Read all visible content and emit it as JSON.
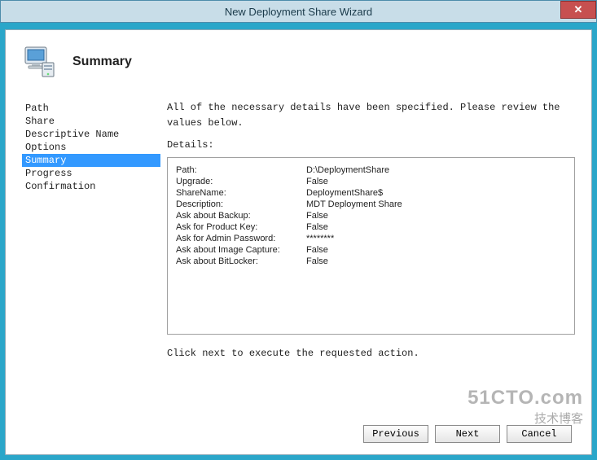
{
  "window": {
    "title": "New Deployment Share Wizard",
    "close": "✕"
  },
  "header": {
    "title": "Summary"
  },
  "nav": {
    "items": [
      {
        "label": "Path",
        "selected": false
      },
      {
        "label": "Share",
        "selected": false
      },
      {
        "label": "Descriptive Name",
        "selected": false
      },
      {
        "label": "Options",
        "selected": false
      },
      {
        "label": "Summary",
        "selected": true
      },
      {
        "label": "Progress",
        "selected": false
      },
      {
        "label": "Confirmation",
        "selected": false
      }
    ]
  },
  "main": {
    "intro": "All of the necessary details have been specified.  Please review the values below.",
    "details_label": "Details:",
    "details": [
      {
        "key": "Path:",
        "value": "D:\\DeploymentShare"
      },
      {
        "key": "Upgrade:",
        "value": "False"
      },
      {
        "key": "ShareName:",
        "value": "DeploymentShare$"
      },
      {
        "key": "Description:",
        "value": "MDT Deployment Share"
      },
      {
        "key": "Ask about Backup:",
        "value": "False"
      },
      {
        "key": "Ask for Product Key:",
        "value": "False"
      },
      {
        "key": "Ask for Admin Password:",
        "value": "********"
      },
      {
        "key": "Ask about Image Capture:",
        "value": "False"
      },
      {
        "key": "Ask about BitLocker:",
        "value": "False"
      }
    ],
    "footer_text": "Click next to execute the requested action."
  },
  "buttons": {
    "previous": "Previous",
    "next": "Next",
    "cancel": "Cancel"
  },
  "watermark": {
    "line1": "51CTO.com",
    "line2": "技术博客"
  }
}
